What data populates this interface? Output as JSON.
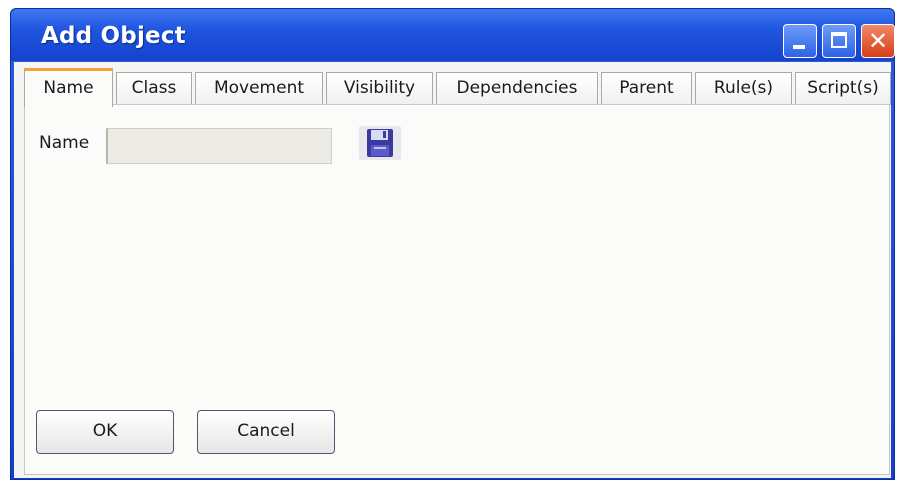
{
  "window": {
    "title": "Add Object",
    "controls": {
      "minimize": "minimize-icon",
      "maximize": "maximize-icon",
      "close": "close-icon"
    },
    "colors": {
      "titlebar": "#1f55e0",
      "close": "#d63d16",
      "active_tab_accent": "#f2a23a"
    }
  },
  "tabs": [
    {
      "label": "Name",
      "active": true
    },
    {
      "label": "Class",
      "active": false
    },
    {
      "label": "Movement",
      "active": false
    },
    {
      "label": "Visibility",
      "active": false
    },
    {
      "label": "Dependencies",
      "active": false
    },
    {
      "label": "Parent",
      "active": false
    },
    {
      "label": "Rule(s)",
      "active": false
    },
    {
      "label": "Script(s)",
      "active": false
    }
  ],
  "form": {
    "name_label": "Name",
    "name_value": "",
    "name_placeholder": "",
    "save_icon": "save-icon"
  },
  "buttons": {
    "ok": "OK",
    "cancel": "Cancel"
  }
}
